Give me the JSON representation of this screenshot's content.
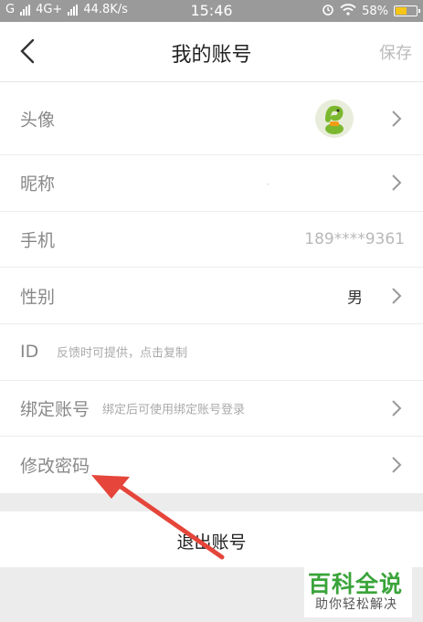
{
  "status_bar": {
    "carrier_left": "G",
    "network": "4G+",
    "speed": "44.8K/s",
    "time": "15:46",
    "battery_percent": "58%",
    "battery_level": 0.58
  },
  "header": {
    "title": "我的账号",
    "save_label": "保存"
  },
  "rows": {
    "avatar": {
      "label": "头像"
    },
    "nickname": {
      "label": "昵称",
      "value": "-"
    },
    "phone": {
      "label": "手机",
      "value": "189****9361"
    },
    "gender": {
      "label": "性别",
      "value": "男"
    },
    "id": {
      "label": "ID",
      "hint": "反馈时可提供，点击复制"
    },
    "bind": {
      "label": "绑定账号",
      "hint": "绑定后可使用绑定账号登录"
    },
    "password": {
      "label": "修改密码"
    }
  },
  "logout_label": "退出账号",
  "watermark": {
    "main": "百科全说",
    "sub": "助你轻松解决"
  },
  "colors": {
    "accent_arrow": "#e5453a",
    "battery_fill": "#f5c518",
    "watermark_green": "#3aa43a"
  }
}
